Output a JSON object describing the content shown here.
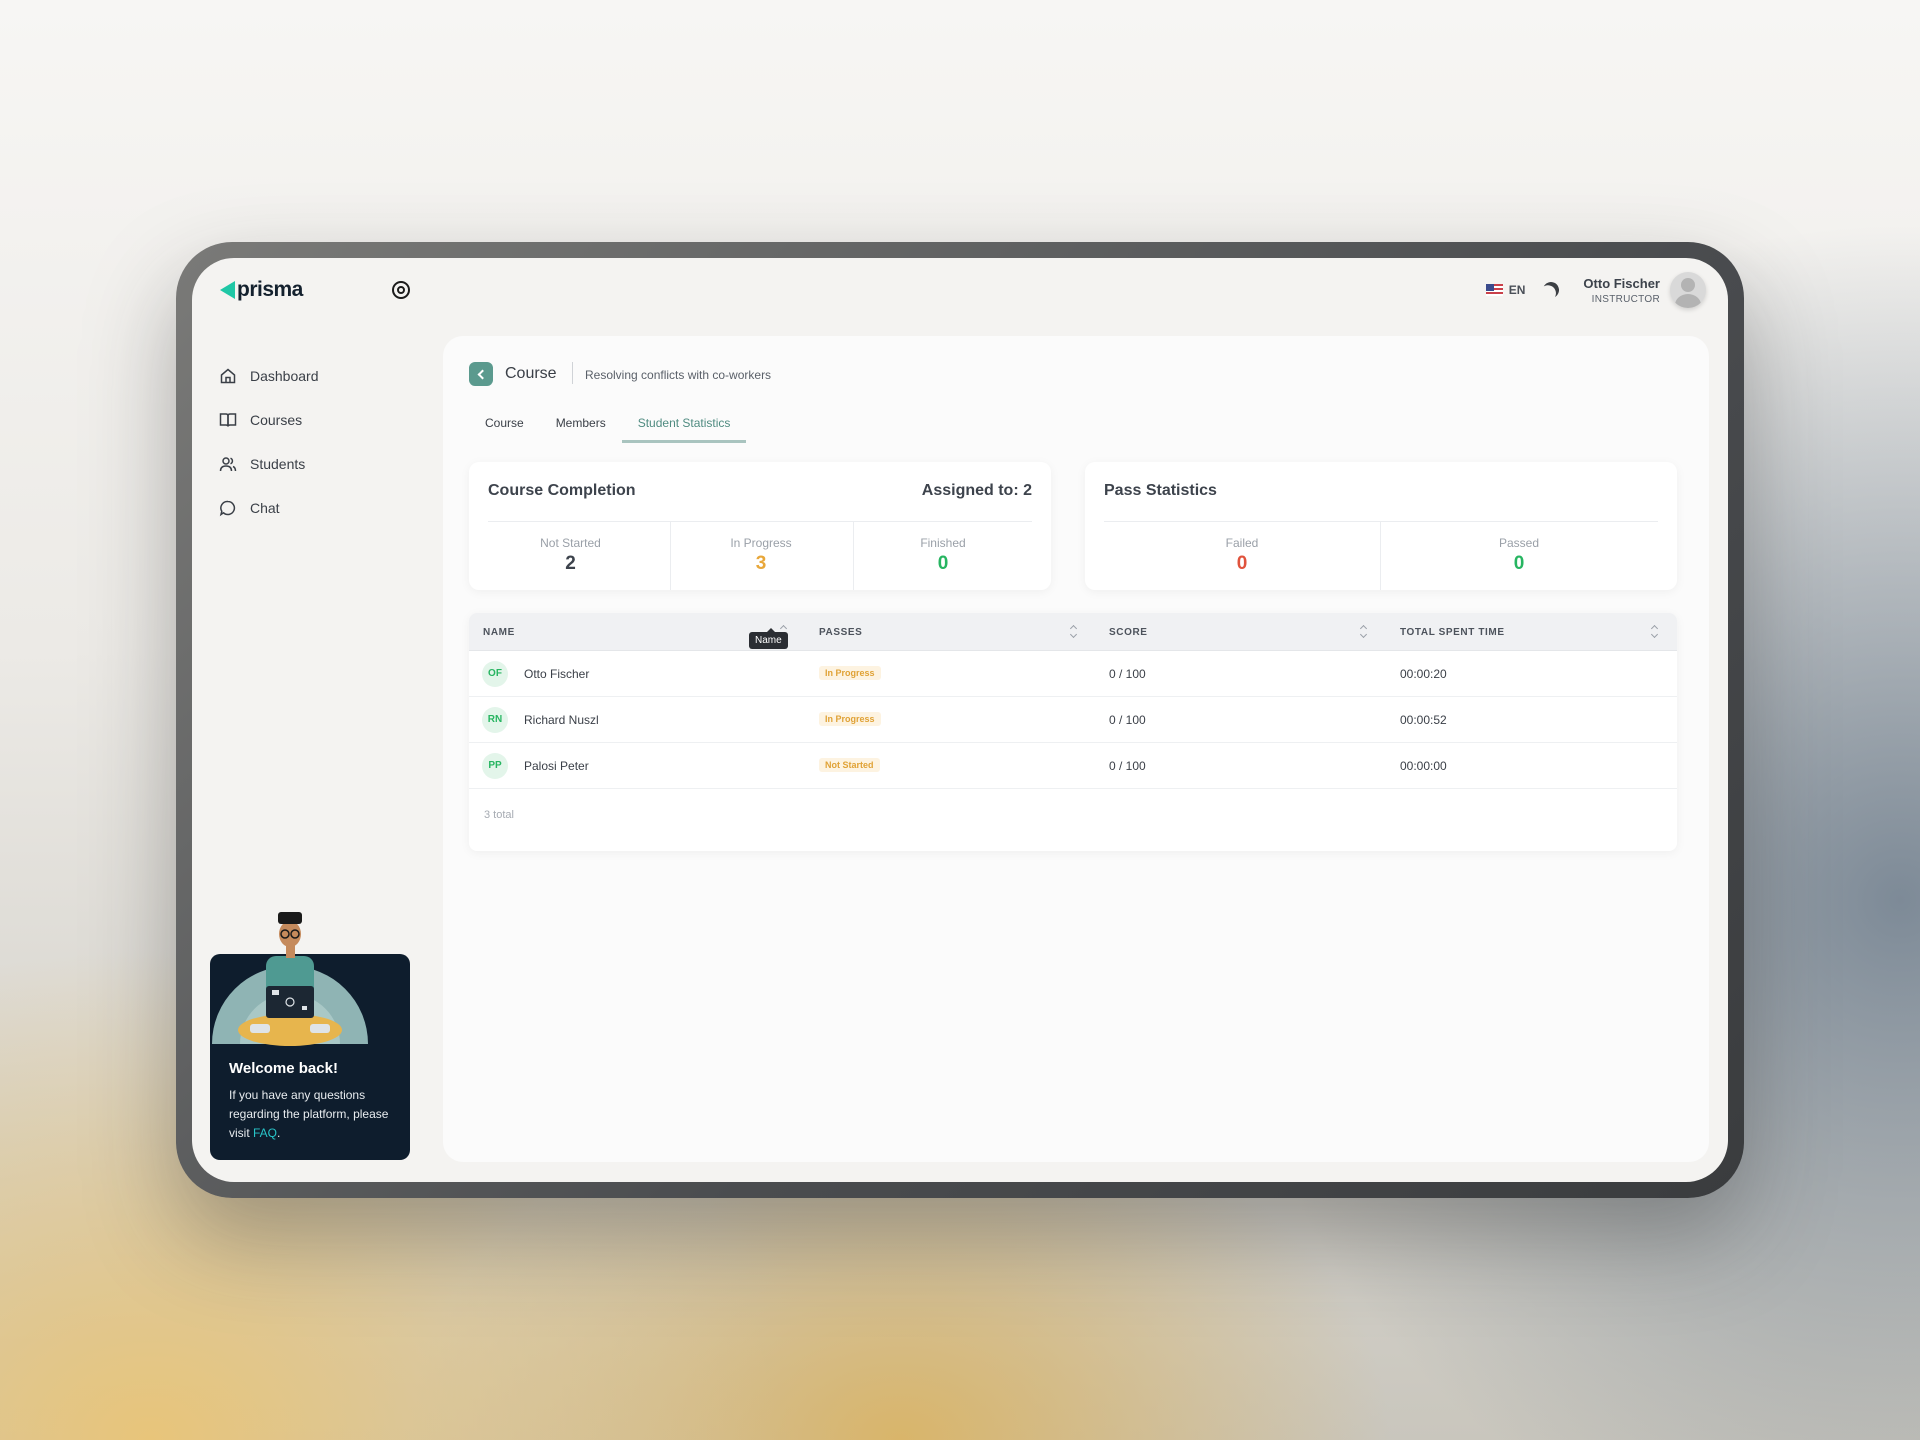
{
  "app": {
    "logo": "prisma"
  },
  "header": {
    "language": "EN",
    "user_name": "Otto Fischer",
    "user_role": "INSTRUCTOR"
  },
  "sidebar": {
    "items": [
      {
        "label": "Dashboard",
        "icon": "home-icon"
      },
      {
        "label": "Courses",
        "icon": "book-icon"
      },
      {
        "label": "Students",
        "icon": "users-icon"
      },
      {
        "label": "Chat",
        "icon": "chat-icon"
      }
    ]
  },
  "welcome": {
    "title": "Welcome back!",
    "text": "If you have any questions regarding the platform, please visit ",
    "link": "FAQ",
    "end": "."
  },
  "breadcrumb": {
    "title": "Course",
    "subtitle": "Resolving conflicts with co-workers"
  },
  "tabs": [
    {
      "label": "Course",
      "active": false
    },
    {
      "label": "Members",
      "active": false
    },
    {
      "label": "Student Statistics",
      "active": true
    }
  ],
  "completion": {
    "title": "Course Completion",
    "assigned": "Assigned to: 2",
    "stats": [
      {
        "label": "Not Started",
        "value": "2",
        "color": "#3d434c"
      },
      {
        "label": "In Progress",
        "value": "3",
        "color": "#e8a73a"
      },
      {
        "label": "Finished",
        "value": "0",
        "color": "#27b561"
      }
    ]
  },
  "pass": {
    "title": "Pass Statistics",
    "stats": [
      {
        "label": "Failed",
        "value": "0",
        "color": "#e0533d"
      },
      {
        "label": "Passed",
        "value": "0",
        "color": "#27b561"
      }
    ]
  },
  "table": {
    "columns": [
      "NAME",
      "PASSES",
      "SCORE",
      "TOTAL SPENT TIME"
    ],
    "tooltip": "Name",
    "rows": [
      {
        "initials": "OF",
        "name": "Otto Fischer",
        "status": "In Progress",
        "score": "0 / 100",
        "time": "00:00:20"
      },
      {
        "initials": "RN",
        "name": "Richard Nuszl",
        "status": "In Progress",
        "score": "0 / 100",
        "time": "00:00:52"
      },
      {
        "initials": "PP",
        "name": "Palosi Peter",
        "status": "Not Started",
        "score": "0 / 100",
        "time": "00:00:00"
      }
    ],
    "total": "3 total"
  }
}
